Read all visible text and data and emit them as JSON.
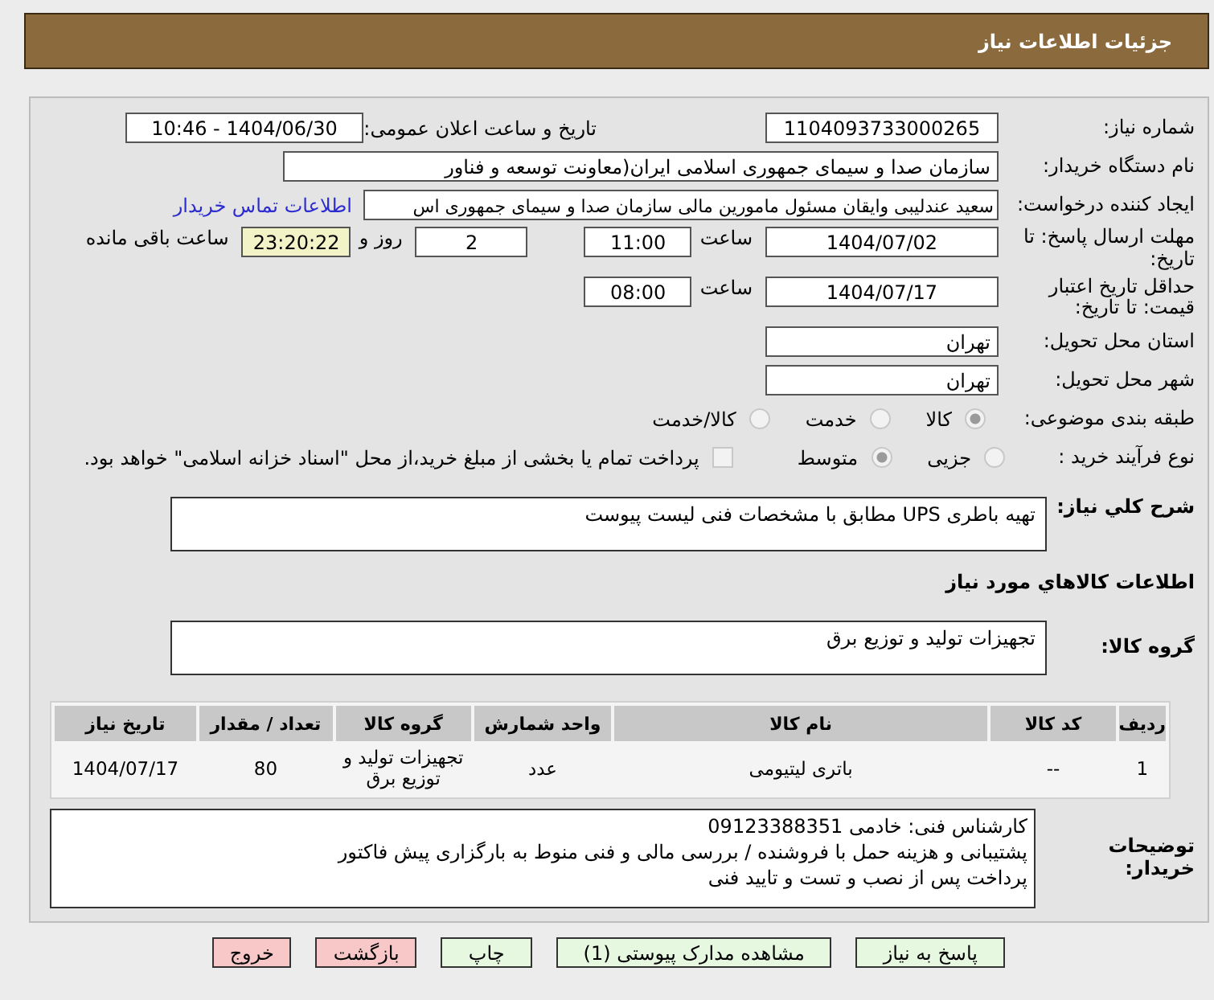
{
  "header": {
    "title": "جزئیات اطلاعات نیاز"
  },
  "need_number": {
    "label": "شماره نیاز:",
    "value": "1104093733000265"
  },
  "announce_datetime": {
    "label": "تاریخ و ساعت اعلان عمومی:",
    "value": "1404/06/30 - 10:46"
  },
  "buyer_org": {
    "label": "نام دستگاه خریدار:",
    "value": "سازمان صدا و سیمای جمهوری اسلامی ایران(معاونت توسعه و فناور"
  },
  "requester": {
    "label": "ایجاد کننده درخواست:",
    "value": "سعید عندلیبی وایقان مسئول مامورین مالی  سازمان صدا و سیمای جمهوری اس",
    "link": "اطلاعات تماس خریدار"
  },
  "response_deadline": {
    "label": "مهلت ارسال پاسخ: تا تاریخ:",
    "date": "1404/07/02",
    "time_label": "ساعت",
    "time": "11:00",
    "days": "2",
    "days_label": "روز و",
    "remaining": "23:20:22",
    "remaining_label": "ساعت باقی مانده"
  },
  "price_validity": {
    "label": "حداقل تاریخ اعتبار قیمت: تا تاریخ:",
    "date": "1404/07/17",
    "time_label": "ساعت",
    "time": "08:00"
  },
  "province": {
    "label": "استان محل تحویل:",
    "value": "تهران"
  },
  "city": {
    "label": "شهر محل تحویل:",
    "value": "تهران"
  },
  "category": {
    "label": "طبقه بندی موضوعی:",
    "options": [
      {
        "label": "کالا",
        "selected": true
      },
      {
        "label": "خدمت",
        "selected": false
      },
      {
        "label": "کالا/خدمت",
        "selected": false
      }
    ]
  },
  "process": {
    "label": "نوع فرآیند خرید :",
    "options": [
      {
        "label": "جزیی",
        "selected": false
      },
      {
        "label": "متوسط",
        "selected": true
      }
    ],
    "payment": {
      "label": "پرداخت تمام یا بخشی از مبلغ خرید،از محل \"اسناد خزانه اسلامی\" خواهد بود.",
      "checked": false
    }
  },
  "description": {
    "label": "شرح کلي نیاز:",
    "value": "تهیه  باطری UPS مطابق با مشخصات فنی لیست پیوست"
  },
  "goods_title": "اطلاعات کالاهاي مورد نیاز",
  "goods_group": {
    "label": "گروه کالا:",
    "value": "تجهیزات تولید و توزیع برق"
  },
  "table": {
    "columns": [
      "ردیف",
      "کد کالا",
      "نام کالا",
      "واحد شمارش",
      "گروه کالا",
      "تعداد / مقدار",
      "تاریخ نیاز"
    ],
    "rows": [
      [
        "1",
        "--",
        "باتری لیتیومی",
        "عدد",
        "تجهیزات تولید و توزیع برق",
        "80",
        "1404/07/17"
      ]
    ]
  },
  "notes": {
    "label": "توضیحات خریدار:",
    "text": "کارشناس فنی: خادمی  09123388351\nپشتیبانی و هزینه حمل با فروشنده / بررسی مالی و فنی منوط به بارگزاری پیش فاکتور\nپرداخت پس از نصب و تست و تایید فنی"
  },
  "buttons": [
    {
      "label": "پاسخ به نیاز",
      "kind": "action"
    },
    {
      "label": "مشاهده مدارک پیوستی (1)",
      "kind": "action"
    },
    {
      "label": "چاپ",
      "kind": "action"
    },
    {
      "label": "بازگشت",
      "kind": "exit"
    },
    {
      "label": "خروج",
      "kind": "exit"
    }
  ]
}
